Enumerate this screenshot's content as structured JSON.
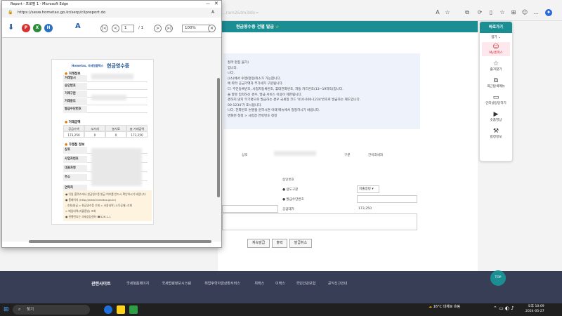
{
  "popup": {
    "window_title": "Report - 프로필 1 - Microsoft Edge",
    "url": "https://sesw.hometax.go.kr/serp/clipreport.do",
    "page_current": "1",
    "page_total": "/ 1",
    "zoom": "100%"
  },
  "receipt": {
    "logo_text": "Hometax, 국세청홈택스",
    "title": "현금영수증",
    "section_trade": "거래정보",
    "trade_rows": [
      "거래일시",
      "승인번호",
      "거래구분",
      "거래용도",
      "발급수단번호"
    ],
    "section_amount": "거래금액",
    "amount_headers": [
      "공급가액",
      "부가세",
      "봉사료",
      "총 거래금액"
    ],
    "amount_values": [
      "173,250",
      "0",
      "0",
      "173,250"
    ],
    "section_store": "가맹점 정보",
    "store_rows": [
      "상호",
      "사업자번호",
      "대표자명",
      "주소",
      "연락처"
    ],
    "info_lines": [
      "● 익일 홈택스에서 현금영수증 발급 여부를 반드시 확인하시기 바랍니다.",
      "● 홈페이지 (http://www.hometax.go.kr)",
      "  - 조회/발급 > 현금영수증 조회 > 사용내역 (소득공제) 조회",
      "  > 매입내역(지출증빙) 조회",
      "● 현행번호는 국세상담센터 ☎126-1-1"
    ]
  },
  "background": {
    "url_fragment": "...ram2&tm3Idx=",
    "header_title": "현금영수증 건별 발급",
    "notice_lines": [
      "잘라 편집 불가)",
      "입니다.",
      "니다.",
      "(/소)에서 수행/정정/취소가 가능합니다.",
      "에 따라 공급가액과 부가세가 구분됩니다.",
      "다. 주민등록번호, 사업자등록번호, 휴대전화번호, 자동 카드번호(13~19자리)입니다.",
      "을 잘못 입력하신 경우, 발급 서비스 이용이 제한됩니다.",
      "경하지 않지 무기명으로 발급하는 경우 국세청 코드 '010-000-1234'번호로 발급하는 제도입니다.",
      "00-1234'가 표시됩니다.",
      "니다. 전화번호 변경을 원하시면 아래 메뉴에서 정정하시기 바랍니다.",
      "변화번 정정 > 사업장 연락번호 정정"
    ],
    "label_store": "상호",
    "label_type": "구분",
    "type_value": "간이과세자",
    "label_approval": "승인번호",
    "label_purpose": "용도구분",
    "purpose_value": "지출증빙",
    "label_issue_no": "발급수단번호",
    "label_supply": "공급대가",
    "supply_value": "173,250",
    "buttons": [
      "계속발급",
      "출력",
      "발급취소"
    ],
    "footer_title": "관련사이트",
    "footer_links": [
      "국세청홈페이지",
      "국세법령정보시스템",
      "취업후학자금상환서비스",
      "위택스",
      "이택스",
      "국민건강보험",
      "공익신고안내"
    ],
    "top_button": "TOP"
  },
  "quick_panel": {
    "title": "바로가기",
    "fold": "접기 ⌄",
    "items": [
      {
        "label": "My홈택스",
        "icon": "person-icon"
      },
      {
        "label": "즐겨찾기",
        "icon": "star-icon"
      },
      {
        "label": "최근탐색메뉴",
        "icon": "recent-icon"
      },
      {
        "label": "인터넷상담하기",
        "icon": "laptop-icon"
      },
      {
        "label": "숏폼영상",
        "icon": "play-icon"
      },
      {
        "label": "법령정보",
        "icon": "gavel-icon"
      }
    ]
  },
  "taskbar": {
    "search": "찾기",
    "weather": "16°C 대체로 흐림",
    "time": "오후 10:09",
    "date": "2024-05-27"
  }
}
